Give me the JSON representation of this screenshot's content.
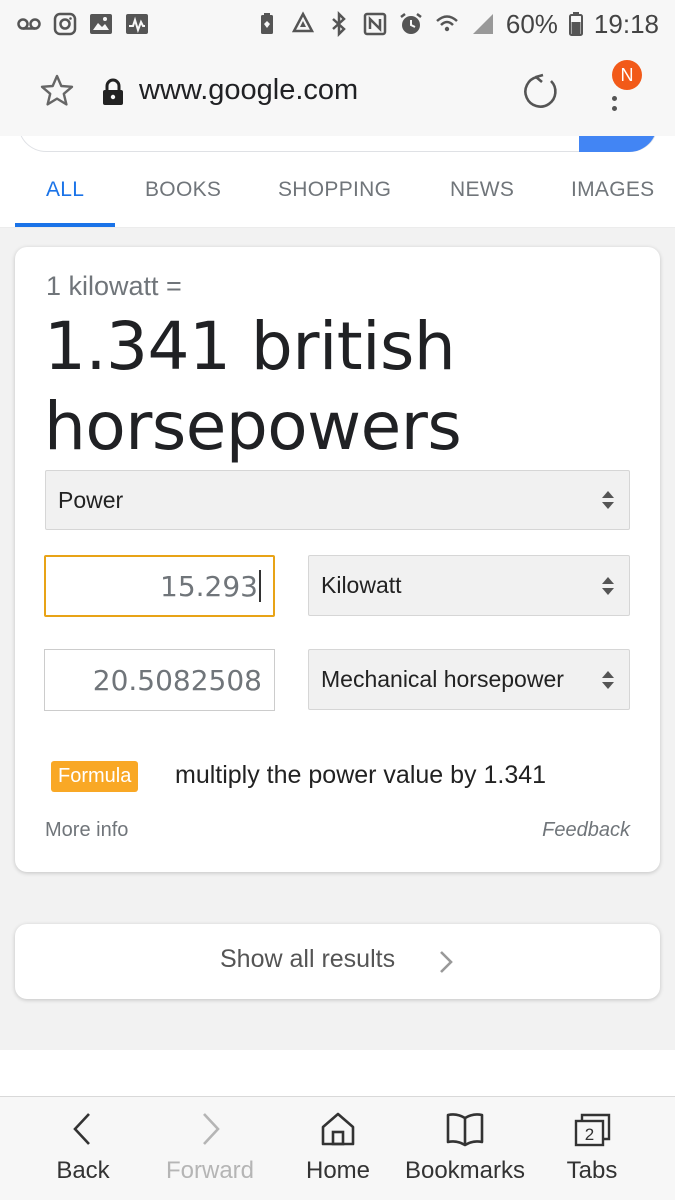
{
  "status_bar": {
    "battery": "60%",
    "time": "19:18"
  },
  "address_bar": {
    "url": "www.google.com",
    "avatar_initial": "N"
  },
  "tabs": [
    {
      "label": "ALL",
      "active": true
    },
    {
      "label": "BOOKS",
      "active": false
    },
    {
      "label": "SHOPPING",
      "active": false
    },
    {
      "label": "NEWS",
      "active": false
    },
    {
      "label": "IMAGES",
      "active": false
    }
  ],
  "converter": {
    "equation": "1 kilowatt =",
    "result": "1.341 british horsepowers",
    "unit_type": "Power",
    "from_value": "15.293",
    "from_unit": "Kilowatt",
    "to_value": "20.5082508",
    "to_unit": "Mechanical horsepower",
    "formula_badge": "Formula",
    "formula_text": "multiply the power value by 1.341",
    "more_info": "More info",
    "feedback": "Feedback"
  },
  "show_all": {
    "label": "Show all results"
  },
  "bottom_nav": [
    {
      "label": "Back",
      "icon": "back-icon",
      "enabled": true
    },
    {
      "label": "Forward",
      "icon": "forward-icon",
      "enabled": false
    },
    {
      "label": "Home",
      "icon": "home-icon",
      "enabled": true
    },
    {
      "label": "Bookmarks",
      "icon": "bookmarks-icon",
      "enabled": true
    },
    {
      "label": "Tabs",
      "icon": "tabs-icon",
      "enabled": true,
      "count": "2"
    }
  ],
  "colors": {
    "accent": "#1a73e8",
    "formula_badge": "#f9a825",
    "avatar": "#f25a19",
    "search_button": "#4285f4"
  }
}
